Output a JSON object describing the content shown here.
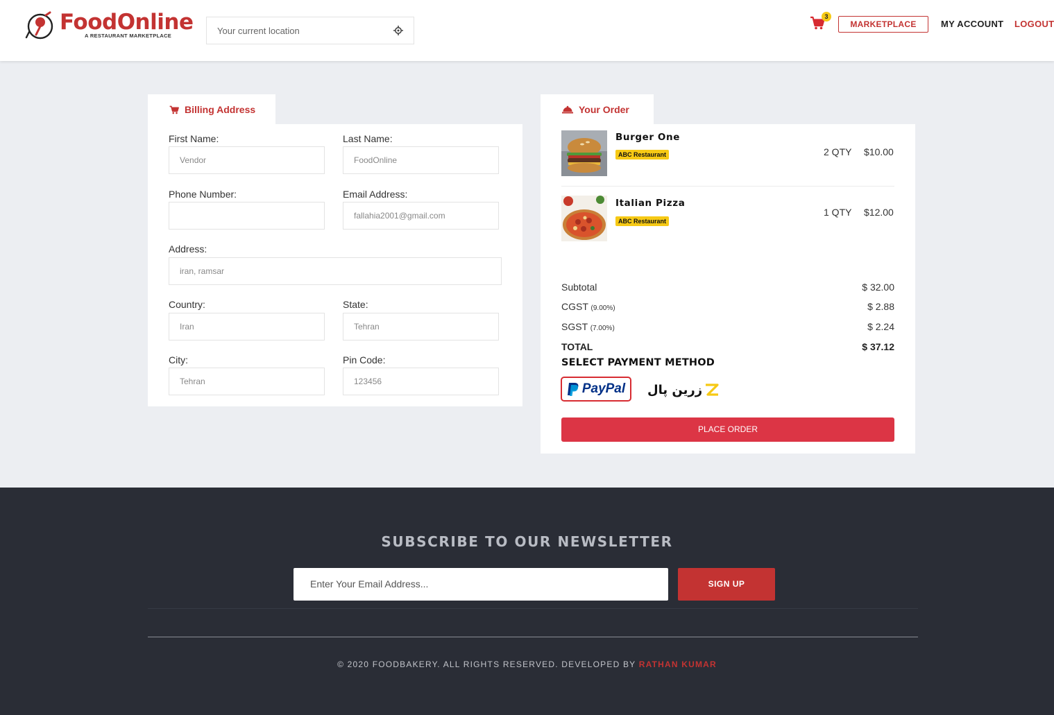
{
  "header": {
    "logo_text": "FoodOnline",
    "logo_tagline": "A RESTAURANT MARKETPLACE",
    "location_placeholder": "Your current location",
    "cart_count": "3",
    "marketplace_label": "MARKETPLACE",
    "my_account_label": "MY ACCOUNT",
    "logout_label": "LOGOUT",
    "brand_color": "#c33332"
  },
  "billing": {
    "tab_label": "Billing Address",
    "fields": {
      "first_name": {
        "label": "First Name:",
        "value": "Vendor"
      },
      "last_name": {
        "label": "Last Name:",
        "value": "FoodOnline"
      },
      "phone": {
        "label": "Phone Number:",
        "value": ""
      },
      "email": {
        "label": "Email Address:",
        "value": "fallahia2001@gmail.com"
      },
      "address": {
        "label": "Address:",
        "value": "iran, ramsar"
      },
      "country": {
        "label": "Country:",
        "value": "Iran"
      },
      "state": {
        "label": "State:",
        "value": "Tehran"
      },
      "city": {
        "label": "City:",
        "value": "Tehran"
      },
      "pin_code": {
        "label": "Pin Code:",
        "value": "123456"
      }
    }
  },
  "order": {
    "tab_label": "Your Order",
    "items": [
      {
        "name": "Burger One",
        "restaurant": "ABC Restaurant",
        "qty": "2 QTY",
        "price": "$10.00"
      },
      {
        "name": "Italian Pizza",
        "restaurant": "ABC Restaurant",
        "qty": "1 QTY",
        "price": "$12.00"
      }
    ],
    "subtotal_label": "Subtotal",
    "subtotal": "$ 32.00",
    "cgst_label": "CGST",
    "cgst_rate": "(9.00%)",
    "cgst": "$ 2.88",
    "sgst_label": "SGST",
    "sgst_rate": "(7.00%)",
    "sgst": "$ 2.24",
    "total_label": "TOTAL",
    "total": "$ 37.12",
    "payment_title": "SELECT PAYMENT METHOD",
    "paypal_label": "PayPal",
    "zarinpal_label": "زرین پال",
    "place_order_label": "PLACE ORDER",
    "accent_color": "#dc3545"
  },
  "footer": {
    "newsletter_title": "SUBSCRIBE TO OUR NEWSLETTER",
    "email_placeholder": "Enter Your Email Address...",
    "signup_label": "SIGN UP",
    "copyright": "© 2020 FOODBAKERY. ALL RIGHTS RESERVED. DEVELOPED BY",
    "developer": "RATHAN KUMAR"
  }
}
